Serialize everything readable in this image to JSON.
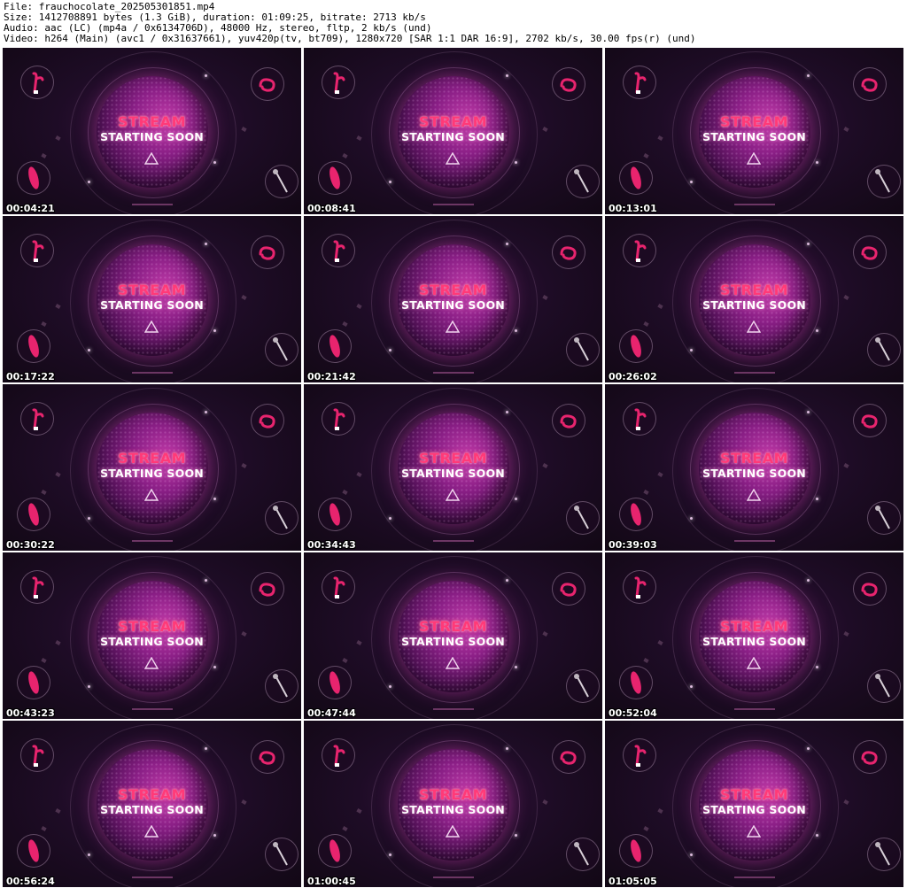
{
  "header": {
    "file_line": "File: frauchocolate_202505301851.mp4",
    "size_line": "Size: 1412708891 bytes (1.3 GiB), duration: 01:09:25, bitrate: 2713 kb/s",
    "audio_line": "Audio: aac (LC) (mp4a / 0x6134706D), 48000 Hz, stereo, fltp, 2 kb/s (und)",
    "video_line": "Video: h264 (Main) (avc1 / 0x31637661), yuv420p(tv, bt709), 1280x720 [SAR 1:1 DAR 16:9], 2702 kb/s, 30.00 fps(r) (und)"
  },
  "thumbnail_text": {
    "title_top": "STREAM",
    "title_bottom": "STARTING SOON"
  },
  "colors": {
    "accent_pink": "#ff3a78",
    "toy_pink": "#e8246e",
    "sphere_purple": "#8a1f86",
    "background_dark": "#1e0c26"
  },
  "icons": [
    "rabbit-vibrator-icon",
    "egg-vibrator-icon",
    "bullet-vibrator-icon",
    "wand-massager-icon",
    "triangle-play-icon"
  ],
  "thumbnails": [
    {
      "timestamp": "00:04:21"
    },
    {
      "timestamp": "00:08:41"
    },
    {
      "timestamp": "00:13:01"
    },
    {
      "timestamp": "00:17:22"
    },
    {
      "timestamp": "00:21:42"
    },
    {
      "timestamp": "00:26:02"
    },
    {
      "timestamp": "00:30:22"
    },
    {
      "timestamp": "00:34:43"
    },
    {
      "timestamp": "00:39:03"
    },
    {
      "timestamp": "00:43:23"
    },
    {
      "timestamp": "00:47:44"
    },
    {
      "timestamp": "00:52:04"
    },
    {
      "timestamp": "00:56:24"
    },
    {
      "timestamp": "01:00:45"
    },
    {
      "timestamp": "01:05:05"
    }
  ]
}
